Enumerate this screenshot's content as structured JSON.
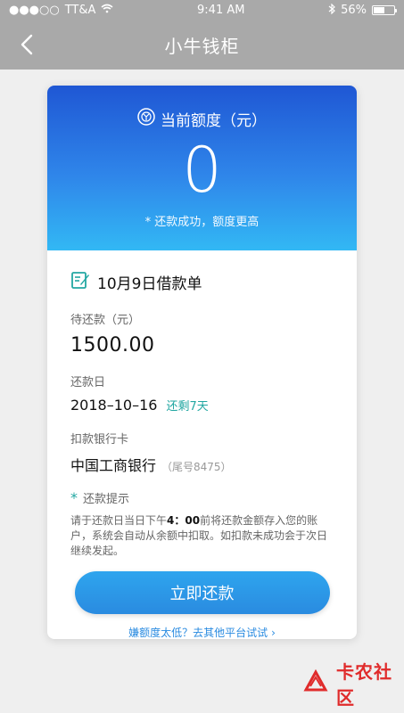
{
  "status_bar": {
    "signal": "●●●○○",
    "carrier": "TT&A",
    "time": "9:41 AM",
    "battery_percent": "56%",
    "battery_level": 0.56
  },
  "navbar": {
    "title": "小牛钱柜"
  },
  "quota": {
    "label": "当前额度（元）",
    "value": "0",
    "note": "* 还款成功，额度更高"
  },
  "loan": {
    "title": "10月9日借款单",
    "due_amount_label": "待还款（元）",
    "due_amount": "1500.00",
    "due_date_label": "还款日",
    "due_date": "2018–10–16",
    "remaining": "还剩7天",
    "bank_label": "扣款银行卡",
    "bank_name": "中国工商银行",
    "bank_tail": "（尾号8475）"
  },
  "tips": {
    "title": "还款提示",
    "text_before": "请于还款日当日下午",
    "text_time": "4：00",
    "text_after": "前将还款金额存入您的账户，系统会自动从余额中扣取。如扣款未成功会于次日继续发起。"
  },
  "actions": {
    "pay_button": "立即还款",
    "low_limit_link": "嫌额度太低？去其他平台试试"
  },
  "watermark": {
    "text": "卡农社区"
  },
  "colors": {
    "header_gray": "#a9a9a9",
    "teal": "#22a7a2",
    "blue": "#2a8be0",
    "red": "#e02b2b"
  }
}
